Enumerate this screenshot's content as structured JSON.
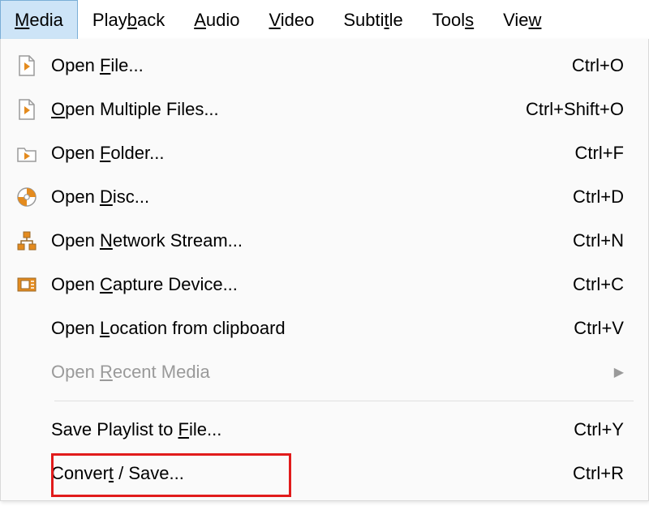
{
  "menubar": {
    "items": [
      {
        "label": "Media",
        "underline_index": 0,
        "active": true
      },
      {
        "label": "Playback",
        "underline_index": 4,
        "active": false
      },
      {
        "label": "Audio",
        "underline_index": 0,
        "active": false
      },
      {
        "label": "Video",
        "underline_index": 0,
        "active": false
      },
      {
        "label": "Subtitle",
        "underline_index": 5,
        "active": false
      },
      {
        "label": "Tools",
        "underline_index": 4,
        "active": false
      },
      {
        "label": "View",
        "underline_index": 3,
        "active": false
      }
    ]
  },
  "dropdown": {
    "items": [
      {
        "icon": "file-play-icon",
        "label": "Open File...",
        "underline_index": 5,
        "shortcut": "Ctrl+O"
      },
      {
        "icon": "file-play-icon",
        "label": "Open Multiple Files...",
        "underline_index": 0,
        "shortcut": "Ctrl+Shift+O"
      },
      {
        "icon": "folder-play-icon",
        "label": "Open Folder...",
        "underline_index": 5,
        "shortcut": "Ctrl+F"
      },
      {
        "icon": "disc-icon",
        "label": "Open Disc...",
        "underline_index": 5,
        "shortcut": "Ctrl+D"
      },
      {
        "icon": "network-icon",
        "label": "Open Network Stream...",
        "underline_index": 5,
        "shortcut": "Ctrl+N"
      },
      {
        "icon": "capture-device-icon",
        "label": "Open Capture Device...",
        "underline_index": 5,
        "shortcut": "Ctrl+C"
      },
      {
        "icon": "",
        "label": "Open Location from clipboard",
        "underline_index": 5,
        "shortcut": "Ctrl+V"
      },
      {
        "icon": "",
        "label": "Open Recent Media",
        "underline_index": 5,
        "shortcut": "",
        "disabled": true,
        "submenu": true
      },
      {
        "separator": true
      },
      {
        "icon": "",
        "label": "Save Playlist to File...",
        "underline_index": 17,
        "shortcut": "Ctrl+Y"
      },
      {
        "icon": "",
        "label": "Convert / Save...",
        "underline_index": 6,
        "shortcut": "Ctrl+R",
        "highlighted": true
      }
    ]
  },
  "colors": {
    "active_menubg": "#cde4f7",
    "highlight_border": "#e11b1b",
    "vlc_orange": "#e48b1e"
  }
}
